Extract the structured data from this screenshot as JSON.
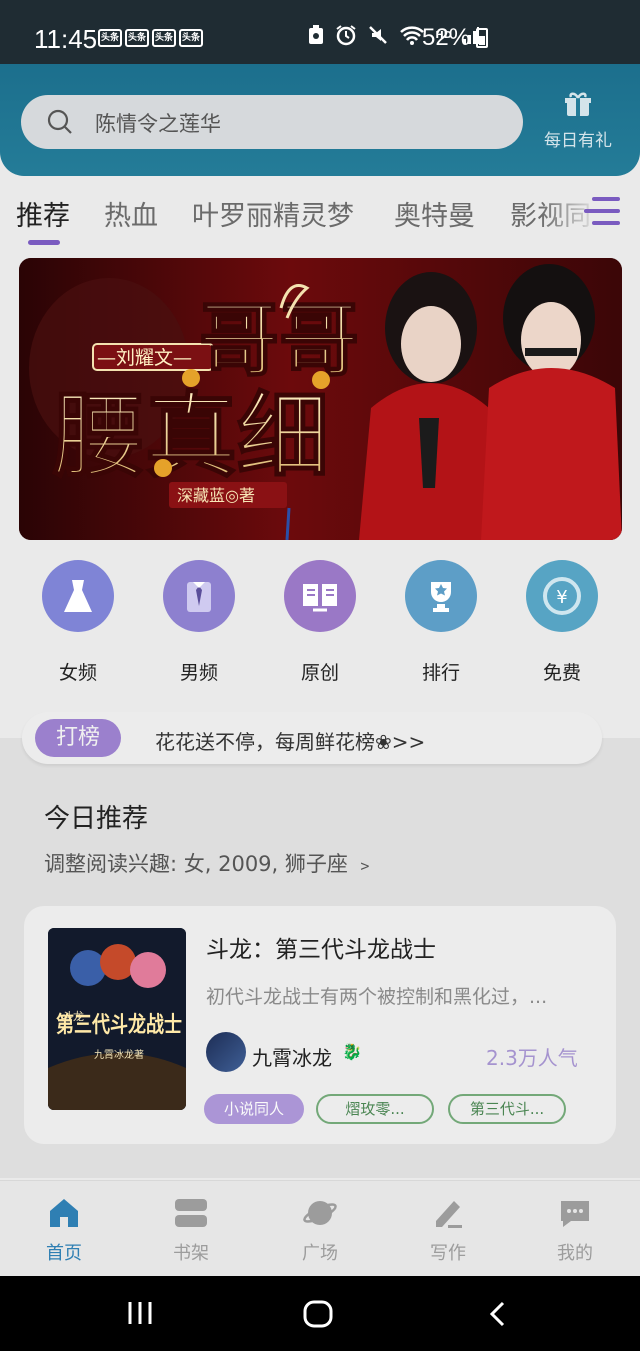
{
  "status": {
    "time": "11:45",
    "news": [
      "头条",
      "头条",
      "头条",
      "头条"
    ],
    "battery": "52%",
    "signal_label": "HD"
  },
  "search": {
    "placeholder": "陈情令之莲华"
  },
  "gift": {
    "label": "每日有礼"
  },
  "tabs": [
    {
      "label": "推荐",
      "active": true
    },
    {
      "label": "热血"
    },
    {
      "label": "叶罗丽精灵梦"
    },
    {
      "label": "奥特曼"
    },
    {
      "label": "影视同"
    }
  ],
  "banner": {
    "artist": "—刘耀文—",
    "title_line1": "哥哥",
    "title_line2": "腰真细",
    "author": "深藏蓝◎著"
  },
  "categories": [
    {
      "label": "女频",
      "icon": "dress-icon",
      "color": "#7f84d6"
    },
    {
      "label": "男频",
      "icon": "shirt-tie-icon",
      "color": "#8d80cf"
    },
    {
      "label": "原创",
      "icon": "open-book-icon",
      "color": "#9a78c6"
    },
    {
      "label": "排行",
      "icon": "trophy-icon",
      "color": "#5d9ec7"
    },
    {
      "label": "免费",
      "icon": "yuan-coin-icon",
      "color": "#57a4c4"
    }
  ],
  "rank": {
    "badge": "打榜",
    "text": "花花送不停，每周鲜花榜❀>>"
  },
  "section": {
    "title": "今日推荐",
    "subtitle": "调整阅读兴趣: 女, 2009, 狮子座 ﹥"
  },
  "book": {
    "title": "斗龙：第三代斗龙战士",
    "description": "初代斗龙战士有两个被控制和黑化过，...",
    "author": "九霄冰龙",
    "author_badge": "🐉",
    "popularity": "2.3万人气",
    "tags": [
      "小说同人",
      "熠玫零...",
      "第三代斗..."
    ],
    "cover_title": "第三代斗龙战士",
    "cover_small_top": "斗龙",
    "cover_author": "九霄冰龙著"
  },
  "nav": [
    {
      "label": "首页",
      "active": true,
      "icon": "home-icon"
    },
    {
      "label": "书架",
      "icon": "bookshelf-icon"
    },
    {
      "label": "广场",
      "icon": "planet-icon"
    },
    {
      "label": "写作",
      "icon": "pencil-icon"
    },
    {
      "label": "我的",
      "icon": "chat-bubble-icon"
    }
  ]
}
